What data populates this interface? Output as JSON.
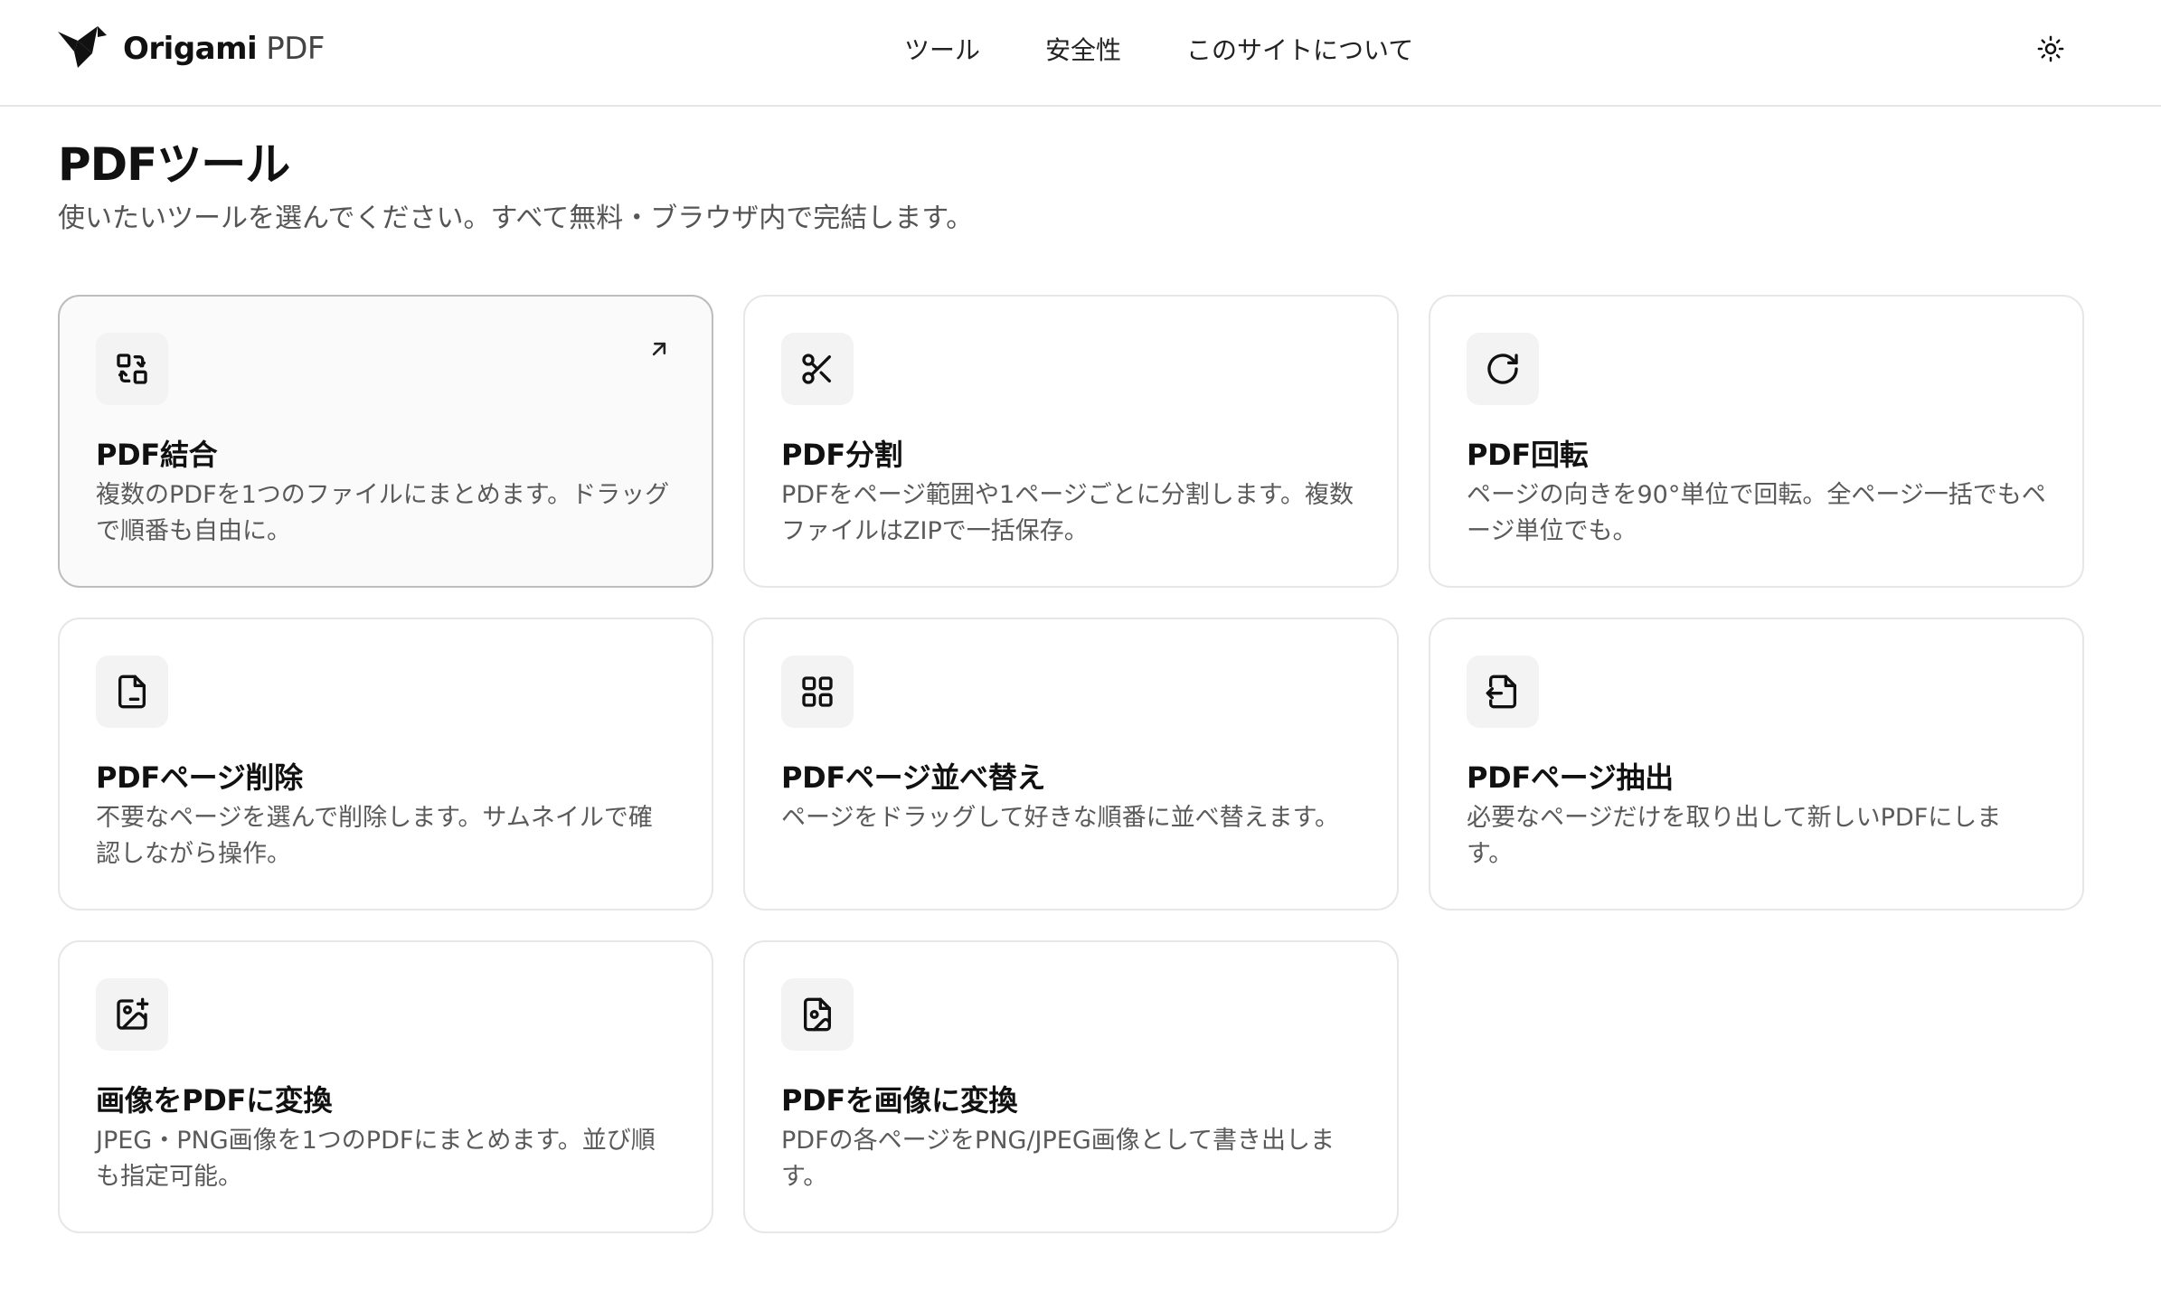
{
  "header": {
    "brand_name": "Origami",
    "brand_sub": "PDF",
    "logo_icon": "origami-crane-icon",
    "nav": [
      "ツール",
      "安全性",
      "このサイトについて"
    ],
    "theme_toggle_icon": "sun-icon"
  },
  "main": {
    "title": "PDFツール",
    "subtitle": "使いたいツールを選んでください。すべて無料・ブラウザ内で完結します。"
  },
  "tools": [
    {
      "icon": "merge-icon",
      "title": "PDF結合",
      "desc": "複数のPDFを1つのファイルにまとめます。ドラッグで順番も自由に。",
      "hovered": true,
      "arrow_icon": "arrow-up-right-icon"
    },
    {
      "icon": "scissors-icon",
      "title": "PDF分割",
      "desc": "PDFをページ範囲や1ページごとに分割します。複数ファイルはZIPで一括保存。"
    },
    {
      "icon": "rotate-icon",
      "title": "PDF回転",
      "desc": "ページの向きを90°単位で回転。全ページ一括でもページ単位でも。"
    },
    {
      "icon": "file-minus-icon",
      "title": "PDFページ削除",
      "desc": "不要なページを選んで削除します。サムネイルで確認しながら操作。"
    },
    {
      "icon": "grid-icon",
      "title": "PDFページ並べ替え",
      "desc": "ページをドラッグして好きな順番に並べ替えます。"
    },
    {
      "icon": "file-export-icon",
      "title": "PDFページ抽出",
      "desc": "必要なページだけを取り出して新しいPDFにします。"
    },
    {
      "icon": "image-plus-icon",
      "title": "画像をPDFに変換",
      "desc": "JPEG・PNG画像を1つのPDFにまとめます。並び順も指定可能。"
    },
    {
      "icon": "file-image-icon",
      "title": "PDFを画像に変換",
      "desc": "PDFの各ページをPNG/JPEG画像として書き出します。"
    }
  ]
}
